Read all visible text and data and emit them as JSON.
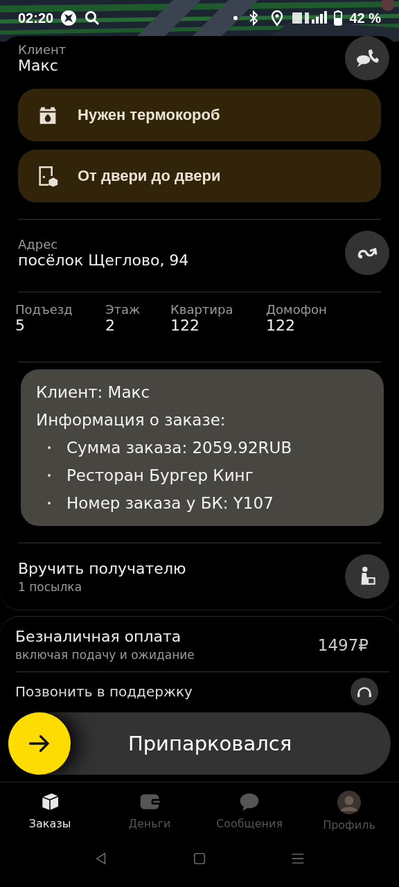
{
  "status_bar": {
    "time": "02:20",
    "battery": "42 %"
  },
  "client": {
    "label": "Клиент",
    "name": "Макс"
  },
  "tags": [
    {
      "kind": "thermo",
      "text": "Нужен термокороб"
    },
    {
      "kind": "door",
      "text": "От двери до двери"
    }
  ],
  "address": {
    "label": "Адрес",
    "value": "посёлок Щеглово, 94"
  },
  "details": [
    {
      "label": "Подъезд",
      "value": "5"
    },
    {
      "label": "Этаж",
      "value": "2"
    },
    {
      "label": "Квартира",
      "value": "122"
    },
    {
      "label": "Домофон",
      "value": "122"
    }
  ],
  "comment": [
    {
      "kind": "plain",
      "text": "Клиент: Макс"
    },
    {
      "kind": "plain",
      "text": "Информация о заказе:"
    },
    {
      "kind": "bullet",
      "text": "Сумма заказа: 2059.92RUB"
    },
    {
      "kind": "bullet",
      "text": "Ресторан Бургер Кинг"
    },
    {
      "kind": "bullet",
      "text": "Номер заказа у БК: Y107"
    }
  ],
  "handover": {
    "title": "Вручить получателю",
    "subtitle": "1 посылка"
  },
  "payment": {
    "title": "Безналичная оплата",
    "subtitle": "включая подачу и ожидание",
    "amount": "1497₽"
  },
  "support": {
    "title": "Позвонить в поддержку"
  },
  "slider": {
    "label": "Припарковался"
  },
  "tabs": [
    {
      "kind": "orders",
      "label": "Заказы",
      "selected": true
    },
    {
      "kind": "money",
      "label": "Деньги",
      "selected": false
    },
    {
      "kind": "messages",
      "label": "Сообщения",
      "selected": false
    },
    {
      "kind": "profile",
      "label": "Профиль",
      "selected": false
    }
  ]
}
